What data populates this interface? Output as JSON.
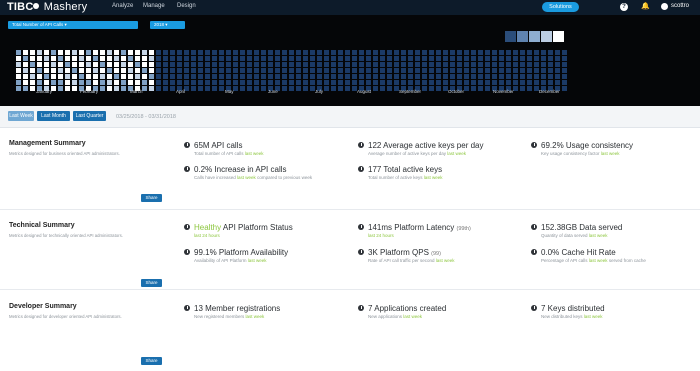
{
  "nav": {
    "logo_bold": "TIBC",
    "logo_rest": " Mashery",
    "items": [
      "Analyze",
      "Manage",
      "Design"
    ],
    "solutions": "Solutions",
    "help": "?",
    "bell": "🔔",
    "user": "scottro"
  },
  "hero": {
    "metric_select": "Total Number of API Calls ▾",
    "year_select": "2018 ▾",
    "months": [
      "January",
      "February",
      "March",
      "April",
      "May",
      "June",
      "July",
      "August",
      "September",
      "October",
      "November",
      "December"
    ],
    "colors": {
      "bg": "#050608",
      "hot": "#ffffff",
      "high": "#c5d4e6",
      "mid": "#7fa0c4",
      "low": "#2b4d7a",
      "none": "#1b3a66",
      "accent": "#1a9be0"
    },
    "legend": [
      "#2b4d7a",
      "#5f83b0",
      "#8eadd0",
      "#bccde2",
      "#ffffff"
    ]
  },
  "range": {
    "tabs": [
      "Last Week",
      "Last Month",
      "Last Quarter"
    ],
    "active_tab": "Last Week",
    "dates": "03/25/2018 - 03/31/2018"
  },
  "sections": [
    {
      "title": "Management Summary",
      "desc": "Metrics designed for business oriented API administrators.",
      "share": "Share",
      "metrics": [
        {
          "pre": "",
          "highlight": "",
          "value": "65M API calls",
          "extra": "",
          "sub": "Total number of API calls",
          "link": "last week",
          "tail": ""
        },
        {
          "pre": "",
          "highlight": "",
          "value": "122 Average active keys per day",
          "extra": "",
          "sub": "Average number of active keys per day",
          "link": "last week",
          "tail": ""
        },
        {
          "pre": "",
          "highlight": "",
          "value": "69.2% Usage consistency",
          "extra": "",
          "sub": "Key usage consistency factor",
          "link": "last week",
          "tail": ""
        },
        {
          "pre": "",
          "highlight": "",
          "value": "0.2% Increase in API calls",
          "extra": "",
          "sub": "Calls have increased",
          "link": "last week",
          "tail": "compared to previous week"
        },
        {
          "pre": "",
          "highlight": "",
          "value": "177 Total active keys",
          "extra": "",
          "sub": "Total number of active keys",
          "link": "last week",
          "tail": ""
        }
      ]
    },
    {
      "title": "Technical Summary",
      "desc": "Metrics designed for technically oriented API administrators.",
      "share": "Share",
      "metrics": [
        {
          "pre": "",
          "highlight": "Healthy",
          "value": " API Platform Status",
          "extra": "",
          "sub": "",
          "link": "last 24 hours",
          "tail": ""
        },
        {
          "pre": "",
          "highlight": "",
          "value": "141ms Platform Latency ",
          "extra": "(99th)",
          "sub": "",
          "link": "last 24 hours",
          "tail": ""
        },
        {
          "pre": "",
          "highlight": "",
          "value": "152.38GB Data served",
          "extra": "",
          "sub": "Quantity of data served",
          "link": "last week",
          "tail": ""
        },
        {
          "pre": "",
          "highlight": "",
          "value": "99.1% Platform Availability",
          "extra": "",
          "sub": "Availability of API Platform",
          "link": "last week",
          "tail": ""
        },
        {
          "pre": "",
          "highlight": "",
          "value": "3K Platform QPS ",
          "extra": "(99)",
          "sub": "Rate of API call traffic per second",
          "link": "last week",
          "tail": ""
        },
        {
          "pre": "",
          "highlight": "",
          "value": "0.0% Cache Hit Rate",
          "extra": "",
          "sub": "Percentage of API calls",
          "link": "last week",
          "tail": "served from cache"
        }
      ]
    },
    {
      "title": "Developer Summary",
      "desc": "Metrics designed for developer oriented API administrators.",
      "share": "Share",
      "metrics": [
        {
          "pre": "",
          "highlight": "",
          "value": "13 Member registrations",
          "extra": "",
          "sub": "New registered members",
          "link": "last week",
          "tail": ""
        },
        {
          "pre": "",
          "highlight": "",
          "value": "7 Applications created",
          "extra": "",
          "sub": "New applications",
          "link": "last week",
          "tail": ""
        },
        {
          "pre": "",
          "highlight": "",
          "value": "7 Keys distributed",
          "extra": "",
          "sub": "New distributed keys",
          "link": "last week",
          "tail": ""
        }
      ]
    }
  ]
}
